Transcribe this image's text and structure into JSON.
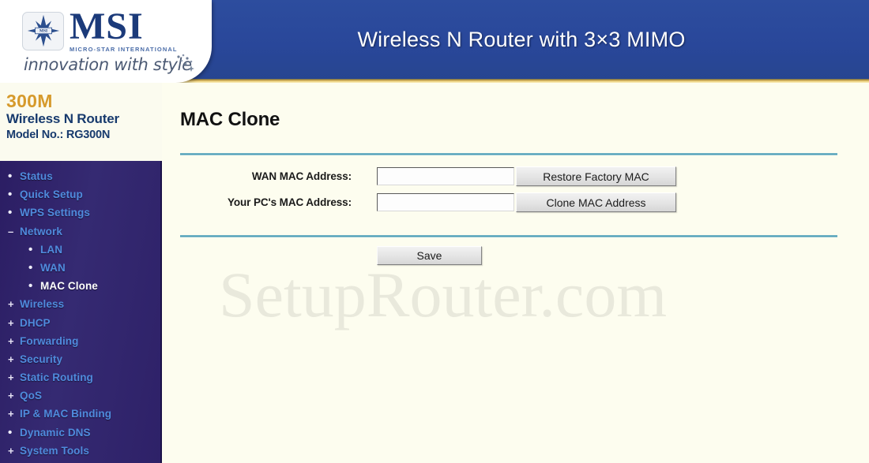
{
  "header": {
    "title": "Wireless N Router with 3×3 MIMO",
    "logo": {
      "brand": "MSI",
      "subtitle": "MICRO-STAR INTERNATIONAL",
      "tagline": "innovation with style",
      "emblem_icon": "msi-star-emblem-icon"
    },
    "accent_color": "#2b4b9b",
    "underline_color": "#c8a44e"
  },
  "sidebar": {
    "brand": {
      "speed": "300M",
      "product": "Wireless N Router",
      "model": "Model No.: RG300N"
    },
    "speed_color": "#d69a2c",
    "product_color": "#173a6d",
    "nav_background": "#2d1f67",
    "link_color": "#4f8bdd",
    "active_color": "#ffffff",
    "items": [
      {
        "label": "Status",
        "marker": "•",
        "marker_type": "dot",
        "level": 0,
        "active": false
      },
      {
        "label": "Quick Setup",
        "marker": "•",
        "marker_type": "dot",
        "level": 0,
        "active": false
      },
      {
        "label": "WPS Settings",
        "marker": "•",
        "marker_type": "dot",
        "level": 0,
        "active": false
      },
      {
        "label": "Network",
        "marker": "–",
        "marker_type": "minus",
        "level": 0,
        "active": false
      },
      {
        "label": "LAN",
        "marker": "•",
        "marker_type": "dot",
        "level": 1,
        "active": false
      },
      {
        "label": "WAN",
        "marker": "•",
        "marker_type": "dot",
        "level": 1,
        "active": false
      },
      {
        "label": "MAC Clone",
        "marker": "•",
        "marker_type": "dot",
        "level": 1,
        "active": true
      },
      {
        "label": "Wireless",
        "marker": "+",
        "marker_type": "plus",
        "level": 0,
        "active": false
      },
      {
        "label": "DHCP",
        "marker": "+",
        "marker_type": "plus",
        "level": 0,
        "active": false
      },
      {
        "label": "Forwarding",
        "marker": "+",
        "marker_type": "plus",
        "level": 0,
        "active": false
      },
      {
        "label": "Security",
        "marker": "+",
        "marker_type": "plus",
        "level": 0,
        "active": false
      },
      {
        "label": "Static Routing",
        "marker": "+",
        "marker_type": "plus",
        "level": 0,
        "active": false
      },
      {
        "label": "QoS",
        "marker": "+",
        "marker_type": "plus",
        "level": 0,
        "active": false
      },
      {
        "label": "IP & MAC Binding",
        "marker": "+",
        "marker_type": "plus",
        "level": 0,
        "active": false
      },
      {
        "label": "Dynamic DNS",
        "marker": "•",
        "marker_type": "dot",
        "level": 0,
        "active": false
      },
      {
        "label": "System Tools",
        "marker": "+",
        "marker_type": "plus",
        "level": 0,
        "active": false
      }
    ]
  },
  "main": {
    "page_title": "MAC Clone",
    "watermark": "SetupRouter.com",
    "divider_color": "#3f94ad",
    "fields": [
      {
        "label": "WAN MAC Address:",
        "value": "",
        "placeholder": "",
        "button": "Restore Factory MAC"
      },
      {
        "label": "Your PC's MAC Address:",
        "value": "",
        "placeholder": "",
        "button": "Clone MAC Address"
      }
    ],
    "save_label": "Save"
  }
}
